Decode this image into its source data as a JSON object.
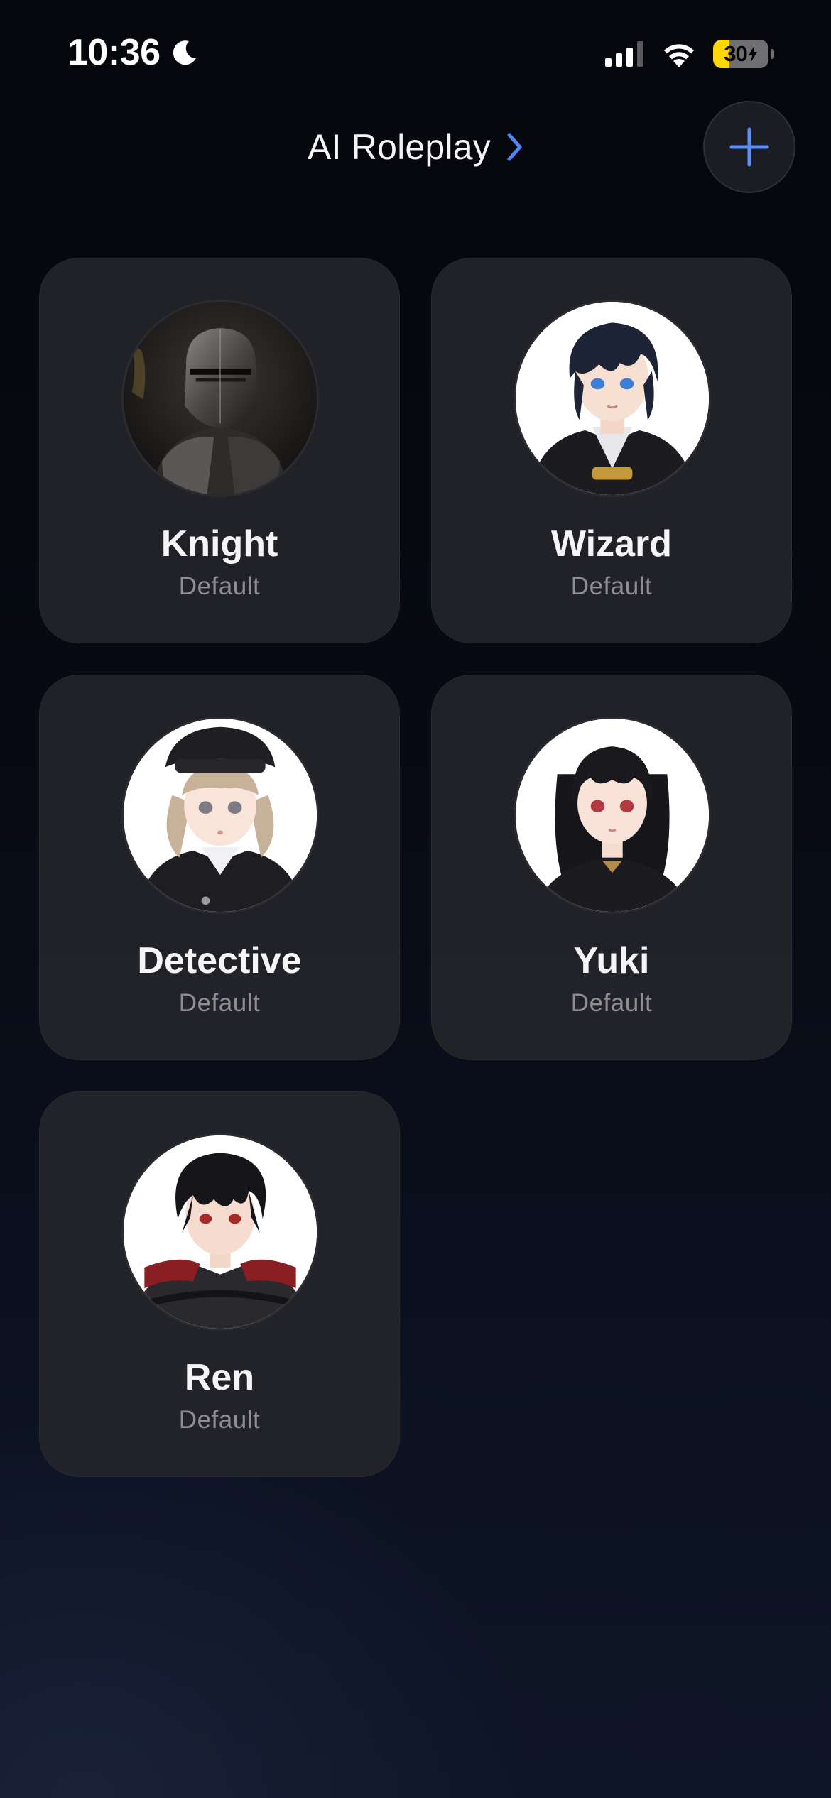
{
  "status_bar": {
    "time": "10:36",
    "battery_level": "30",
    "battery_fraction": 0.3,
    "icons": [
      "moon-icon",
      "cellular-signal-icon",
      "wifi-icon",
      "battery-charging-icon"
    ]
  },
  "header": {
    "title": "AI Roleplay",
    "chevron_icon": "chevron-right-icon",
    "add_icon": "plus-icon"
  },
  "colors": {
    "accent": "#4f86f7",
    "card_background": "#24252a",
    "subtitle": "#8e8e93",
    "battery_yellow": "#ffd60a"
  },
  "characters": [
    {
      "name": "Knight",
      "subtitle": "Default",
      "avatar": "knight-avatar"
    },
    {
      "name": "Wizard",
      "subtitle": "Default",
      "avatar": "wizard-avatar"
    },
    {
      "name": "Detective",
      "subtitle": "Default",
      "avatar": "detective-avatar"
    },
    {
      "name": "Yuki",
      "subtitle": "Default",
      "avatar": "yuki-avatar"
    },
    {
      "name": "Ren",
      "subtitle": "Default",
      "avatar": "ren-avatar"
    }
  ]
}
